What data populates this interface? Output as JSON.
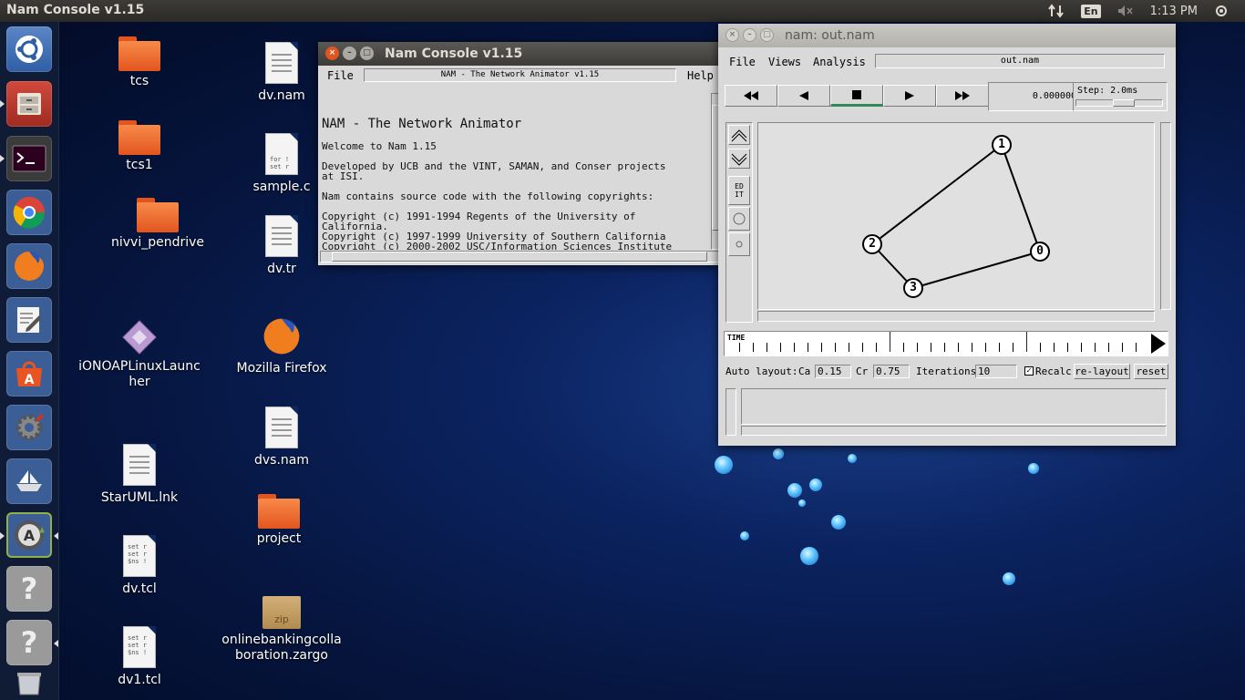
{
  "top_panel": {
    "title": "Nam Console v1.15",
    "lang": "En",
    "time": "1:13 PM"
  },
  "desktop": {
    "icons": [
      {
        "label": "tcs"
      },
      {
        "label": "tcs1"
      },
      {
        "label": "nivvi_pendrive"
      },
      {
        "label": "iONOAPLinuxLauncher"
      },
      {
        "label": "StarUML.lnk"
      },
      {
        "label": "dv.tcl"
      },
      {
        "label": "dv1.tcl"
      },
      {
        "label": "dv.nam"
      },
      {
        "label": "sample.c"
      },
      {
        "label": "dv.tr"
      },
      {
        "label": "Mozilla Firefox"
      },
      {
        "label": "dvs.nam"
      },
      {
        "label": "project"
      },
      {
        "label": "onlinebankingcollaboration.zargo"
      }
    ],
    "doc_snippets": {
      "sample_c": "for !\nset r",
      "dv_tcl": "set r\nset r\n$ns !",
      "dv1_tcl": "set r\nset r\n$ns !"
    },
    "zip_label": "zip"
  },
  "console": {
    "title": "Nam Console v1.15",
    "menu": {
      "file": "File",
      "help": "Help"
    },
    "header_text": "NAM - The Network Animator v1.15",
    "heading": "NAM - The Network Animator",
    "lines": [
      "Welcome to Nam 1.15",
      "Developed by UCB and the VINT, SAMAN, and Conser projects\nat ISI.",
      "Nam contains source code with the following copyrights:",
      "Copyright (c) 1991-1994 Regents of the University of\nCalifornia.\nCopyright (c) 1997-1999 University of Southern California\nCopyright (c) 2000-2002 USC/Information Sciences Institute"
    ]
  },
  "nam": {
    "title": "nam: out.nam",
    "menu": {
      "file": "File",
      "views": "Views",
      "analysis": "Analysis"
    },
    "filename": "out.nam",
    "time_value": "0.000000",
    "step_label": "Step: 2.0ms",
    "edit_label": "ED\nIT",
    "timeline_label": "TIME",
    "nodes": [
      {
        "label": "0"
      },
      {
        "label": "1"
      },
      {
        "label": "2"
      },
      {
        "label": "3"
      }
    ],
    "links": [
      [
        "1",
        "2"
      ],
      [
        "1",
        "0"
      ],
      [
        "2",
        "3"
      ],
      [
        "3",
        "0"
      ]
    ],
    "autolayout": {
      "label": "Auto layout:",
      "ca_label": "Ca",
      "ca_value": "0.15",
      "cr_label": "Cr",
      "cr_value": "0.75",
      "iter_label": "Iterations",
      "iter_value": "10",
      "recalc_label": "Recalc",
      "recalc_checked": true,
      "relayout_label": "re-layout",
      "reset_label": "reset"
    }
  }
}
